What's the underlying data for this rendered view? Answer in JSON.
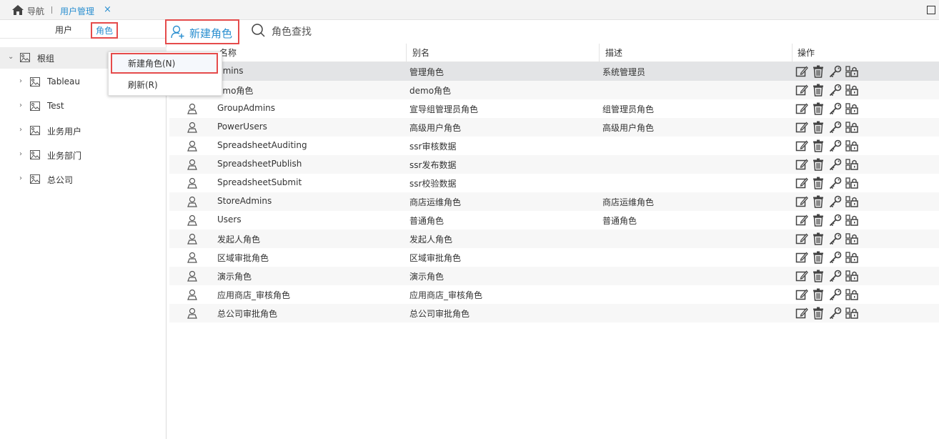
{
  "topbar": {
    "nav_label": "导航",
    "tab_label": "用户管理",
    "close_glyph": "×"
  },
  "left_tabs": {
    "users": "用户",
    "roles": "角色"
  },
  "tree": {
    "root": "根组",
    "children": [
      "Tableau",
      "Test",
      "业务用户",
      "业务部门",
      "总公司"
    ]
  },
  "context_menu": {
    "new_role": "新建角色(N)",
    "refresh": "刷新(R)"
  },
  "toolbar": {
    "new_role": "新建角色",
    "find_role": "角色查找"
  },
  "table": {
    "headers": {
      "name": "名称",
      "alias": "别名",
      "desc": "描述",
      "ops": "操作"
    },
    "rows": [
      {
        "name": "dmins",
        "alias": "管理角色",
        "desc": "系统管理员"
      },
      {
        "name": "emo角色",
        "alias": "demo角色",
        "desc": ""
      },
      {
        "name": "GroupAdmins",
        "alias": "宣导组管理员角色",
        "desc": "组管理员角色"
      },
      {
        "name": "PowerUsers",
        "alias": "高级用户角色",
        "desc": "高级用户角色"
      },
      {
        "name": "SpreadsheetAuditing",
        "alias": "ssr审核数据",
        "desc": ""
      },
      {
        "name": "SpreadsheetPublish",
        "alias": "ssr发布数据",
        "desc": ""
      },
      {
        "name": "SpreadsheetSubmit",
        "alias": "ssr校验数据",
        "desc": ""
      },
      {
        "name": "StoreAdmins",
        "alias": "商店运维角色",
        "desc": "商店运维角色"
      },
      {
        "name": "Users",
        "alias": "普通角色",
        "desc": "普通角色"
      },
      {
        "name": "发起人角色",
        "alias": "发起人角色",
        "desc": ""
      },
      {
        "name": "区域审批角色",
        "alias": "区域审批角色",
        "desc": ""
      },
      {
        "name": "演示角色",
        "alias": "演示角色",
        "desc": ""
      },
      {
        "name": "应用商店_审核角色",
        "alias": "应用商店_审核角色",
        "desc": ""
      },
      {
        "name": "总公司审批角色",
        "alias": "总公司审批角色",
        "desc": ""
      }
    ]
  },
  "colors": {
    "accent": "#2a8fd0",
    "highlight_border": "#e54b4b",
    "selected_row": "#e3e4e6"
  }
}
